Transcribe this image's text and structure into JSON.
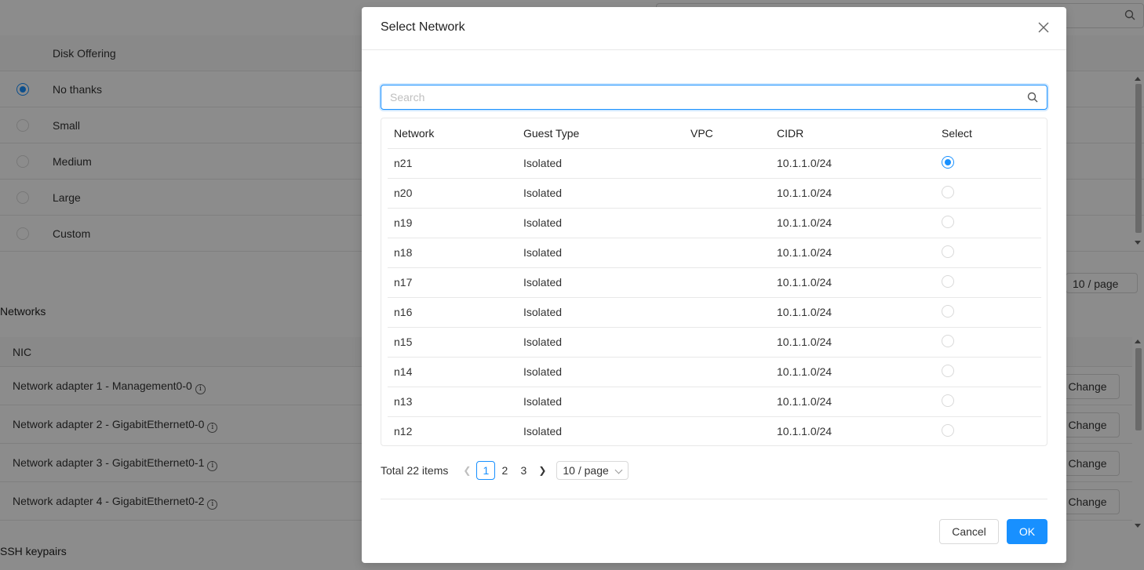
{
  "background": {
    "disk_offering": {
      "header": "Disk Offering",
      "options": [
        {
          "label": "No thanks",
          "selected": true
        },
        {
          "label": "Small",
          "selected": false
        },
        {
          "label": "Medium",
          "selected": false
        },
        {
          "label": "Large",
          "selected": false
        },
        {
          "label": "Custom",
          "selected": false
        }
      ],
      "page_size": "10 / page"
    },
    "networks": {
      "title": "Networks",
      "column_header": "NIC",
      "rows": [
        {
          "label": "Network adapter 1 - Management0-0",
          "button": "Change"
        },
        {
          "label": "Network adapter 2 - GigabitEthernet0-0",
          "button": "Change"
        },
        {
          "label": "Network adapter 3 - GigabitEthernet0-1",
          "button": "Change"
        },
        {
          "label": "Network adapter 4 - GigabitEthernet0-2",
          "button": "Change"
        }
      ]
    },
    "ssh_title": "SSH keypairs"
  },
  "modal": {
    "title": "Select Network",
    "search": {
      "placeholder": "Search",
      "value": ""
    },
    "table": {
      "columns": [
        "Network",
        "Guest Type",
        "VPC",
        "CIDR",
        "Select"
      ],
      "rows": [
        {
          "network": "n21",
          "guest_type": "Isolated",
          "vpc": "",
          "cidr": "10.1.1.0/24",
          "selected": true
        },
        {
          "network": "n20",
          "guest_type": "Isolated",
          "vpc": "",
          "cidr": "10.1.1.0/24",
          "selected": false
        },
        {
          "network": "n19",
          "guest_type": "Isolated",
          "vpc": "",
          "cidr": "10.1.1.0/24",
          "selected": false
        },
        {
          "network": "n18",
          "guest_type": "Isolated",
          "vpc": "",
          "cidr": "10.1.1.0/24",
          "selected": false
        },
        {
          "network": "n17",
          "guest_type": "Isolated",
          "vpc": "",
          "cidr": "10.1.1.0/24",
          "selected": false
        },
        {
          "network": "n16",
          "guest_type": "Isolated",
          "vpc": "",
          "cidr": "10.1.1.0/24",
          "selected": false
        },
        {
          "network": "n15",
          "guest_type": "Isolated",
          "vpc": "",
          "cidr": "10.1.1.0/24",
          "selected": false
        },
        {
          "network": "n14",
          "guest_type": "Isolated",
          "vpc": "",
          "cidr": "10.1.1.0/24",
          "selected": false
        },
        {
          "network": "n13",
          "guest_type": "Isolated",
          "vpc": "",
          "cidr": "10.1.1.0/24",
          "selected": false
        },
        {
          "network": "n12",
          "guest_type": "Isolated",
          "vpc": "",
          "cidr": "10.1.1.0/24",
          "selected": false
        }
      ]
    },
    "pagination": {
      "total": "Total 22 items",
      "pages": [
        "1",
        "2",
        "3"
      ],
      "current": "1",
      "page_size": "10 / page"
    },
    "buttons": {
      "cancel": "Cancel",
      "ok": "OK"
    }
  },
  "colors": {
    "primary": "#1890ff",
    "mask": "rgba(0,0,0,0.45)"
  },
  "icons": [
    "search-icon",
    "close-icon",
    "info-icon",
    "chevron-left-icon",
    "chevron-right-icon",
    "chevron-down-icon"
  ]
}
